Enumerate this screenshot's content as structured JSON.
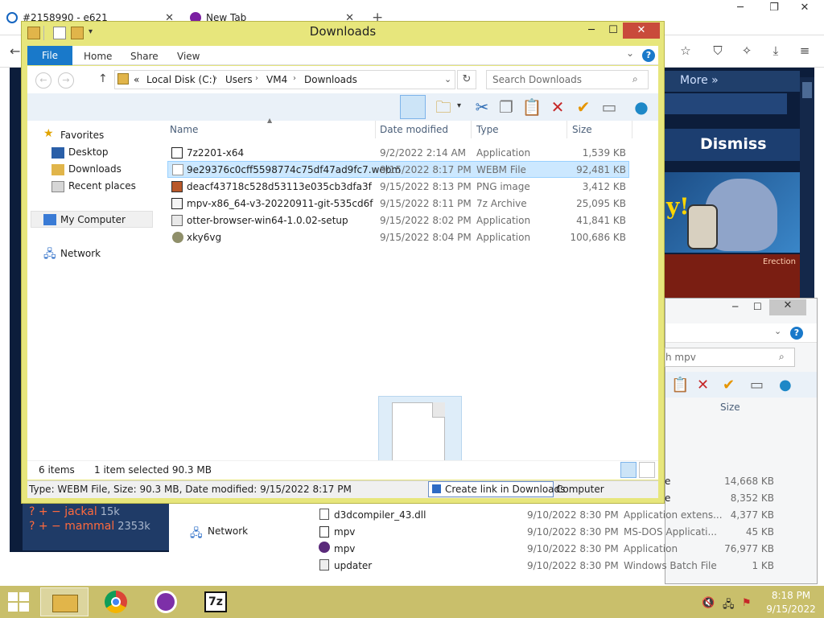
{
  "browser": {
    "tabs": [
      {
        "label": "#2158990 - e621"
      },
      {
        "label": "New Tab"
      }
    ],
    "close_glyph": "✕",
    "new_tab_glyph": "+",
    "window_controls": {
      "minimize": "─",
      "restore": "❐",
      "close": "✕"
    },
    "icons": [
      "back-icon",
      "star-icon",
      "shield-icon",
      "extensions-icon",
      "download-icon",
      "menu-icon"
    ]
  },
  "webpage": {
    "more_link": "More »",
    "dismiss": "Dismiss",
    "banner_text": "y!",
    "ad_text": "Erection",
    "tags": [
      {
        "text": "? + − jackal",
        "count": "15k"
      },
      {
        "text": "? + − mammal",
        "count": "2353k"
      }
    ]
  },
  "explorer": {
    "title": "Downloads",
    "ribbon_tabs": [
      "File",
      "Home",
      "Share",
      "View"
    ],
    "help": "?",
    "nav_back": "←",
    "nav_forward": "→",
    "up": "↑",
    "breadcrumb_prefix": "«",
    "breadcrumb": [
      "Local Disk (C:)",
      "Users",
      "VM4",
      "Downloads"
    ],
    "breadcrumb_sep": "›",
    "search_placeholder": "Search Downloads",
    "columns": {
      "name": "Name",
      "date": "Date modified",
      "type": "Type",
      "size": "Size"
    },
    "nav_pane": {
      "favorites": "Favorites",
      "desktop": "Desktop",
      "downloads": "Downloads",
      "recent": "Recent places",
      "my_computer": "My Computer",
      "network": "Network"
    },
    "files": [
      {
        "name": "7z2201-x64",
        "date": "9/2/2022 2:14 AM",
        "type": "Application",
        "size": "1,539 KB",
        "icon": "7z-exe-icon"
      },
      {
        "name": "9e29376c0cff5598774c75df47ad9fc7.webm",
        "date": "9/15/2022 8:17 PM",
        "type": "WEBM File",
        "size": "92,481 KB",
        "icon": "blank-file-icon",
        "selected": true
      },
      {
        "name": "deacf43718c528d53113e035cb3dfa3f",
        "date": "9/15/2022 8:13 PM",
        "type": "PNG image",
        "size": "3,412 KB",
        "icon": "png-image-icon"
      },
      {
        "name": "mpv-x86_64-v3-20220911-git-535cd6f",
        "date": "9/15/2022 8:11 PM",
        "type": "7z Archive",
        "size": "25,095 KB",
        "icon": "7z-archive-icon"
      },
      {
        "name": "otter-browser-win64-1.0.02-setup",
        "date": "9/15/2022 8:02 PM",
        "type": "Application",
        "size": "41,841 KB",
        "icon": "installer-icon"
      },
      {
        "name": "xky6vg",
        "date": "9/15/2022 8:04 PM",
        "type": "Application",
        "size": "100,686 KB",
        "icon": "app-exe-icon"
      }
    ],
    "status": {
      "items": "6 items",
      "selected": "1 item selected  90.3 MB"
    },
    "details_tooltip": "Type: WEBM File, Size: 90.3 MB, Date modified: 9/15/2022 8:17 PM",
    "drag_tip": "Create link in Downloads",
    "drag_tip_target": "Computer"
  },
  "explorer2": {
    "search_partial": "h mpv",
    "size_header": "Size",
    "help": "?",
    "controls": {
      "minimize": "─",
      "maximize": "☐",
      "close": "✕"
    },
    "network": "Network",
    "partial_rows": [
      {
        "frag": "e",
        "size": "14,668 KB"
      },
      {
        "frag": "e",
        "size": "8,352 KB"
      }
    ],
    "rows": [
      {
        "name": "d3dcompiler_43.dll",
        "date": "9/10/2022 8:30 PM",
        "type": "Application extens...",
        "size": "4,377 KB"
      },
      {
        "name": "mpv",
        "date": "9/10/2022 8:30 PM",
        "type": "MS-DOS Applicati...",
        "size": "45 KB"
      },
      {
        "name": "mpv",
        "date": "9/10/2022 8:30 PM",
        "type": "Application",
        "size": "76,977 KB"
      },
      {
        "name": "updater",
        "date": "9/10/2022 8:30 PM",
        "type": "Windows Batch File",
        "size": "1 KB"
      }
    ]
  },
  "taskbar": {
    "apps": [
      "file-explorer-icon",
      "chrome-icon",
      "tor-browser-icon",
      "7zip-icon"
    ],
    "seven_zip_label": "7z",
    "time": "8:18 PM",
    "date": "9/15/2022"
  }
}
